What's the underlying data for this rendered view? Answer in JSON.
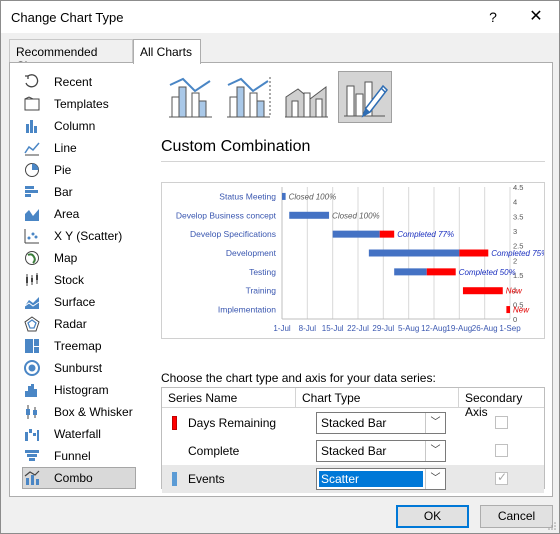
{
  "window": {
    "title": "Change Chart Type",
    "help": "?",
    "close": "✕"
  },
  "tabs": [
    {
      "label": "Recommended Charts",
      "active": false
    },
    {
      "label": "All Charts",
      "active": true
    }
  ],
  "nav": [
    {
      "label": "Recent",
      "icon": "recent-icon"
    },
    {
      "label": "Templates",
      "icon": "templates-icon"
    },
    {
      "label": "Column",
      "icon": "column-chart-icon"
    },
    {
      "label": "Line",
      "icon": "line-chart-icon"
    },
    {
      "label": "Pie",
      "icon": "pie-chart-icon"
    },
    {
      "label": "Bar",
      "icon": "bar-chart-icon"
    },
    {
      "label": "Area",
      "icon": "area-chart-icon"
    },
    {
      "label": "X Y (Scatter)",
      "icon": "scatter-chart-icon"
    },
    {
      "label": "Map",
      "icon": "map-chart-icon"
    },
    {
      "label": "Stock",
      "icon": "stock-chart-icon"
    },
    {
      "label": "Surface",
      "icon": "surface-chart-icon"
    },
    {
      "label": "Radar",
      "icon": "radar-chart-icon"
    },
    {
      "label": "Treemap",
      "icon": "treemap-chart-icon"
    },
    {
      "label": "Sunburst",
      "icon": "sunburst-chart-icon"
    },
    {
      "label": "Histogram",
      "icon": "histogram-chart-icon"
    },
    {
      "label": "Box & Whisker",
      "icon": "box-whisker-chart-icon"
    },
    {
      "label": "Waterfall",
      "icon": "waterfall-chart-icon"
    },
    {
      "label": "Funnel",
      "icon": "funnel-chart-icon"
    },
    {
      "label": "Combo",
      "icon": "combo-chart-icon",
      "selected": true
    }
  ],
  "subtypes": [
    {
      "name": "clustered-column-line-icon",
      "selected": false
    },
    {
      "name": "clustered-column-line-secondary-icon",
      "selected": false
    },
    {
      "name": "stacked-area-clustered-column-icon",
      "selected": false
    },
    {
      "name": "custom-combination-icon",
      "selected": true
    }
  ],
  "main": {
    "subtype_title": "Custom Combination"
  },
  "chart_data": {
    "type": "bar",
    "subtype": "gantt-stacked-bar-with-scatter",
    "categories": [
      "Status Meeting",
      "Develop Business concept",
      "Develop Specifications",
      "Development",
      "Testing",
      "Training",
      "Implementation"
    ],
    "x_ticks": [
      "1-Jul",
      "8-Jul",
      "15-Jul",
      "22-Jul",
      "29-Jul",
      "5-Aug",
      "12-Aug",
      "19-Aug",
      "26-Aug",
      "1-Sep"
    ],
    "xlim": [
      "2019-07-01",
      "2019-09-02"
    ],
    "y2_ticks": [
      "4.5",
      "4",
      "3.5",
      "3",
      "2.5",
      "2",
      "1.5",
      "1",
      "0.5",
      "0"
    ],
    "y2lim": [
      0,
      4.5
    ],
    "series": [
      {
        "name": "Complete",
        "color": "#4472c4",
        "values": [
          {
            "start": "2019-07-01",
            "end": "2019-07-02"
          },
          {
            "start": "2019-07-03",
            "end": "2019-07-14"
          },
          {
            "start": "2019-07-15",
            "end": "2019-07-28"
          },
          {
            "start": "2019-07-25",
            "end": "2019-08-19"
          },
          {
            "start": "2019-08-01",
            "end": "2019-08-10"
          },
          null,
          null
        ]
      },
      {
        "name": "Days Remaining",
        "color": "#ff0000",
        "values": [
          null,
          null,
          {
            "start": "2019-07-28",
            "end": "2019-08-01"
          },
          {
            "start": "2019-08-19",
            "end": "2019-08-27"
          },
          {
            "start": "2019-08-10",
            "end": "2019-08-18"
          },
          {
            "start": "2019-08-20",
            "end": "2019-08-31"
          },
          {
            "start": "2019-09-01",
            "end": "2019-09-02"
          }
        ]
      }
    ],
    "annotations": [
      {
        "task": "Status Meeting",
        "text": "Closed 100%",
        "style": "gray"
      },
      {
        "task": "Develop Business concept",
        "text": "Closed 100%",
        "style": "gray"
      },
      {
        "task": "Develop Specifications",
        "text": "Completed 77%",
        "style": "blue"
      },
      {
        "task": "Development",
        "text": "Completed 75%",
        "style": "blue"
      },
      {
        "task": "Testing",
        "text": "Completed 50%",
        "style": "blue"
      },
      {
        "task": "Training",
        "text": "New",
        "style": "red"
      },
      {
        "task": "Implementation",
        "text": "New",
        "style": "red"
      }
    ],
    "grid": true,
    "legend": "none"
  },
  "series_section": {
    "prompt": "Choose the chart type and axis for your data series:",
    "headers": {
      "name": "Series Name",
      "type": "Chart Type",
      "axis": "Secondary Axis"
    },
    "rows": [
      {
        "name": "Days Remaining",
        "color": "#ff0000",
        "type": "Stacked Bar",
        "secondary": false,
        "selected": false
      },
      {
        "name": "Complete",
        "color": "#ffffff",
        "type": "Stacked Bar",
        "secondary": false,
        "selected": false
      },
      {
        "name": "Events",
        "color": "#5b9bd5",
        "type": "Scatter",
        "secondary": true,
        "selected": true
      }
    ]
  },
  "footer": {
    "ok": "OK",
    "cancel": "Cancel"
  }
}
